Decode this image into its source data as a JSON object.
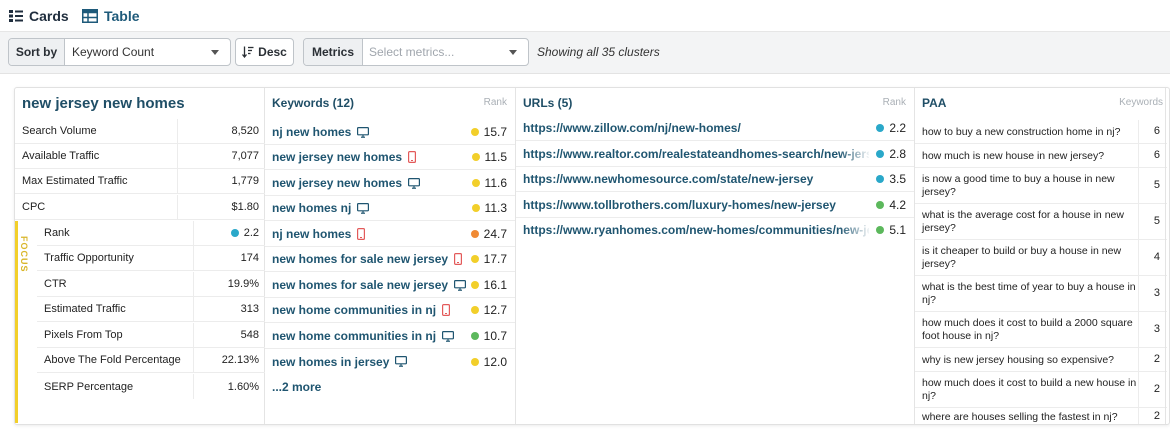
{
  "view_tabs": {
    "cards": "Cards",
    "table": "Table"
  },
  "toolbar": {
    "sort_label": "Sort by",
    "sort_value": "Keyword Count",
    "order_label": "Desc",
    "metrics_label": "Metrics",
    "metrics_placeholder": "Select metrics...",
    "summary": "Showing all 35 clusters"
  },
  "card": {
    "title": "new jersey new homes",
    "metrics": [
      {
        "label": "Search Volume",
        "value": "8,520"
      },
      {
        "label": "Available Traffic",
        "value": "7,077"
      },
      {
        "label": "Max Estimated Traffic",
        "value": "1,779"
      },
      {
        "label": "CPC",
        "value": "$1.80"
      }
    ],
    "focus_label": "FOCUS",
    "focus_metrics": [
      {
        "label": "Rank",
        "value": "2.2",
        "dot": "#2aa8c9"
      },
      {
        "label": "Traffic Opportunity",
        "value": "174"
      },
      {
        "label": "CTR",
        "value": "19.9%"
      },
      {
        "label": "Estimated Traffic",
        "value": "313"
      },
      {
        "label": "Pixels From Top",
        "value": "548"
      },
      {
        "label": "Above The Fold Percentage",
        "value": "22.13%"
      },
      {
        "label": "SERP Percentage",
        "value": "1.60%"
      }
    ],
    "keywords_header": "Keywords (12)",
    "keywords_sub": "Rank",
    "keywords": [
      {
        "text": "nj new homes",
        "device": "desktop-icon",
        "rank": "15.7",
        "dot": "#f2cf2a"
      },
      {
        "text": "new jersey new homes",
        "device": "mobile-icon",
        "rank": "11.5",
        "dot": "#f2cf2a"
      },
      {
        "text": "new jersey new homes",
        "device": "desktop-icon",
        "rank": "11.6",
        "dot": "#f2cf2a"
      },
      {
        "text": "new homes nj",
        "device": "desktop-icon",
        "rank": "11.3",
        "dot": "#f2cf2a"
      },
      {
        "text": "nj new homes",
        "device": "mobile-icon",
        "rank": "24.7",
        "dot": "#f08a34"
      },
      {
        "text": "new homes for sale new jersey",
        "device": "mobile-icon",
        "rank": "17.7",
        "dot": "#f2cf2a"
      },
      {
        "text": "new homes for sale new jersey",
        "device": "desktop-icon",
        "rank": "16.1",
        "dot": "#f2cf2a"
      },
      {
        "text": "new home communities in nj",
        "device": "mobile-icon",
        "rank": "12.7",
        "dot": "#f2cf2a"
      },
      {
        "text": "new home communities in nj",
        "device": "desktop-icon",
        "rank": "10.7",
        "dot": "#5cb85c"
      },
      {
        "text": "new homes in jersey",
        "device": "desktop-icon",
        "rank": "12.0",
        "dot": "#f2cf2a"
      }
    ],
    "keywords_more": "...2 more",
    "urls_header": "URLs (5)",
    "urls_sub": "Rank",
    "urls": [
      {
        "text": "https://www.zillow.com/nj/new-homes/",
        "rank": "2.2",
        "dot": "#2aa8c9"
      },
      {
        "text": "https://www.realtor.com/realestateandhomes-search/new-jers",
        "rank": "2.8",
        "dot": "#2aa8c9"
      },
      {
        "text": "https://www.newhomesource.com/state/new-jersey",
        "rank": "3.5",
        "dot": "#2aa8c9"
      },
      {
        "text": "https://www.tollbrothers.com/luxury-homes/new-jersey",
        "rank": "4.2",
        "dot": "#5cb85c"
      },
      {
        "text": "https://www.ryanhomes.com/new-homes/communities/new-je",
        "rank": "5.1",
        "dot": "#5cb85c"
      }
    ],
    "paa_header": "PAA",
    "paa_sub": "Keywords",
    "paa": [
      {
        "q": "how to buy a new construction home in nj?",
        "n": "6"
      },
      {
        "q": "how much is new house in new jersey?",
        "n": "6"
      },
      {
        "q": "is now a good time to buy a house in new jersey?",
        "n": "5"
      },
      {
        "q": "what is the average cost for a house in new jersey?",
        "n": "5"
      },
      {
        "q": "is it cheaper to build or buy a house in new jersey?",
        "n": "4"
      },
      {
        "q": "what is the best time of year to buy a house in nj?",
        "n": "3"
      },
      {
        "q": "how much does it cost to build a 2000 square foot house in nj?",
        "n": "3"
      },
      {
        "q": "why is new jersey housing so expensive?",
        "n": "2"
      },
      {
        "q": "how much does it cost to build a new house in nj?",
        "n": "2"
      },
      {
        "q": "where are houses selling the fastest in nj?",
        "n": "2"
      }
    ]
  }
}
